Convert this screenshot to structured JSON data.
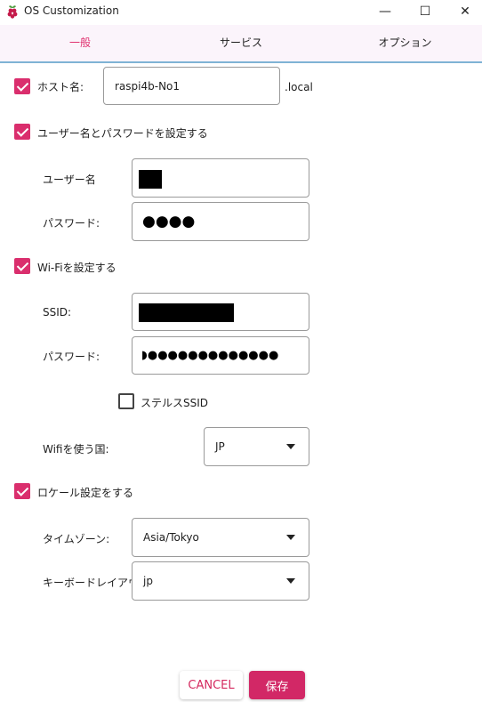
{
  "window": {
    "title": "OS Customization",
    "minimize_glyph": "—",
    "maximize_glyph": "☐",
    "close_glyph": "✕"
  },
  "tabs": [
    {
      "label": "一般",
      "active": true
    },
    {
      "label": "サービス",
      "active": false
    },
    {
      "label": "オプション",
      "active": false
    }
  ],
  "hostname": {
    "label": "ホスト名:",
    "value": "raspi4b-No1",
    "suffix": ".local",
    "checked": true
  },
  "user": {
    "section_label": "ユーザー名とパスワードを設定する",
    "checked": true,
    "username_label": "ユーザー名",
    "password_label": "パスワード:",
    "password_mask": "●●●●"
  },
  "wifi": {
    "section_label": "Wi-Fiを設定する",
    "checked": true,
    "ssid_label": "SSID:",
    "password_label": "パスワード:",
    "password_mask": "◗●●●●●●●●●●●●●",
    "hidden_ssid_label": "ステルスSSID",
    "hidden_ssid_checked": false,
    "country_label": "Wifiを使う国:",
    "country_value": "JP"
  },
  "locale": {
    "section_label": "ロケール設定をする",
    "checked": true,
    "timezone_label": "タイムゾーン:",
    "timezone_value": "Asia/Tokyo",
    "keyboard_label": "キーボードレイアウト:",
    "keyboard_value": "jp"
  },
  "buttons": {
    "cancel": "CANCEL",
    "save": "保存"
  },
  "colors": {
    "accent": "#da2e6d",
    "tab_bar_bg": "#fbf4fb",
    "tab_underline": "#7fb3d5"
  }
}
